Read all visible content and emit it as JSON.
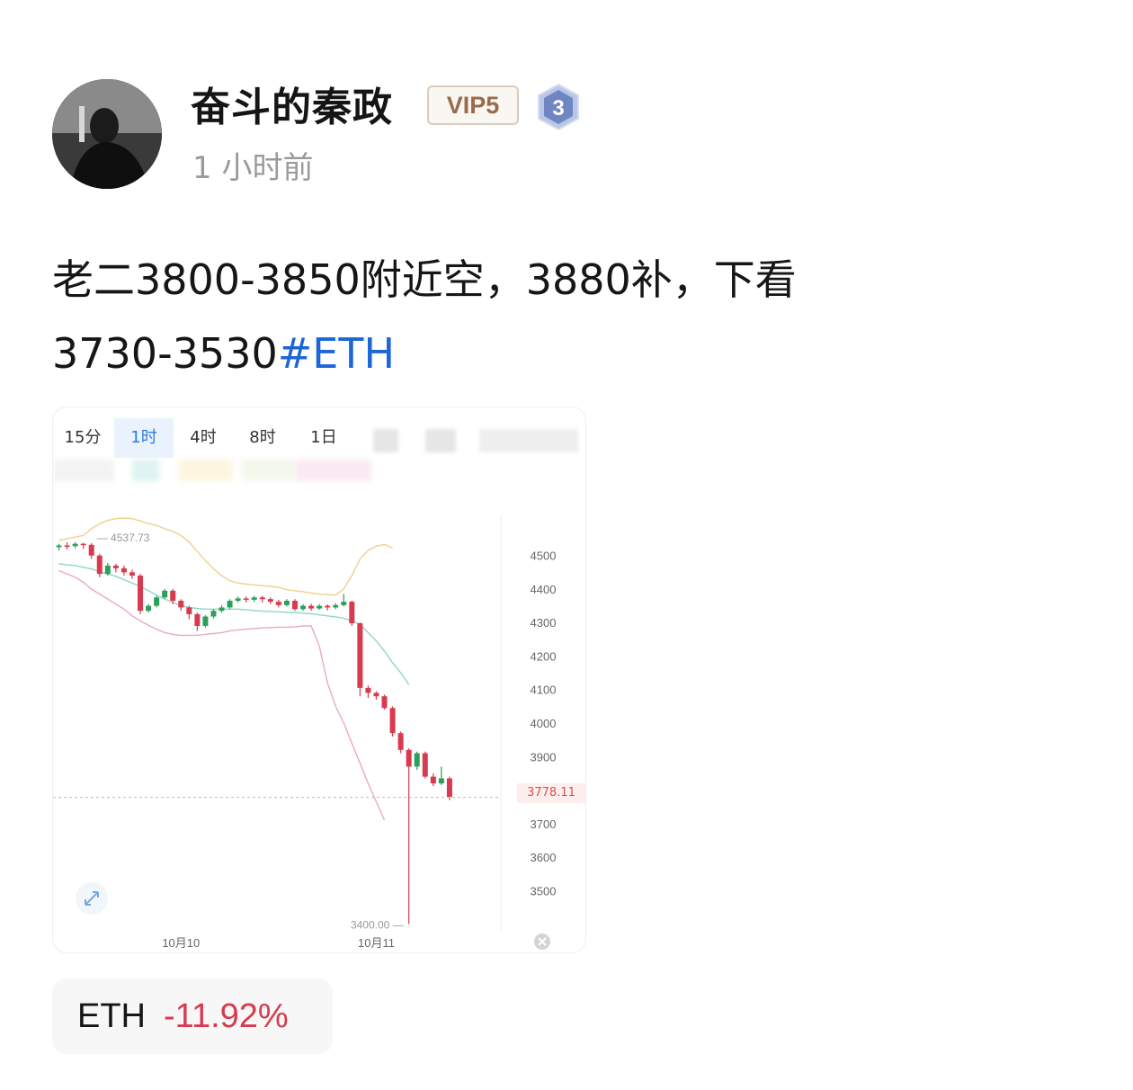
{
  "user": {
    "name": "奋斗的秦政",
    "vip": "VIP5",
    "level": "3",
    "time": "1 小时前"
  },
  "post": {
    "text": "老二3800-3850附近空，3880补，下看3730-3530",
    "hashtag": "#ETH"
  },
  "colors": {
    "up": "#2e9e5b",
    "down": "#d83a4f",
    "link": "#1d66d8"
  },
  "chart_tabs": [
    {
      "label": "15分",
      "active": false
    },
    {
      "label": "1时",
      "active": true
    },
    {
      "label": "4时",
      "active": false
    },
    {
      "label": "8时",
      "active": false
    },
    {
      "label": "1日",
      "active": false
    }
  ],
  "chart_data": {
    "type": "candlestick",
    "symbol": "ETH",
    "interval": "1时",
    "y_ticks": [
      4500,
      4400,
      4300,
      4200,
      4100,
      4000,
      3900,
      3700,
      3600,
      3500
    ],
    "ylim": [
      3380,
      4620
    ],
    "x_labels": [
      {
        "label": "10月10",
        "index": 15
      },
      {
        "label": "10月11",
        "index": 39
      }
    ],
    "high_label": "4537.73",
    "low_label": "3400.00",
    "current_price": "3778.11",
    "candles": [
      [
        4525,
        4530,
        4515,
        4535
      ],
      [
        4530,
        4528,
        4518,
        4540
      ],
      [
        4528,
        4535,
        4522,
        4540
      ],
      [
        4535,
        4532,
        4520,
        4538
      ],
      [
        4532,
        4500,
        4490,
        4537
      ],
      [
        4500,
        4445,
        4435,
        4505
      ],
      [
        4445,
        4470,
        4440,
        4478
      ],
      [
        4470,
        4462,
        4450,
        4475
      ],
      [
        4462,
        4450,
        4440,
        4470
      ],
      [
        4450,
        4440,
        4430,
        4458
      ],
      [
        4440,
        4335,
        4325,
        4445
      ],
      [
        4335,
        4350,
        4330,
        4355
      ],
      [
        4350,
        4375,
        4345,
        4380
      ],
      [
        4375,
        4395,
        4370,
        4400
      ],
      [
        4395,
        4365,
        4355,
        4400
      ],
      [
        4365,
        4345,
        4335,
        4370
      ],
      [
        4345,
        4325,
        4310,
        4350
      ],
      [
        4325,
        4290,
        4275,
        4330
      ],
      [
        4290,
        4318,
        4285,
        4322
      ],
      [
        4318,
        4335,
        4312,
        4340
      ],
      [
        4335,
        4345,
        4330,
        4352
      ],
      [
        4345,
        4365,
        4340,
        4370
      ],
      [
        4365,
        4372,
        4360,
        4378
      ],
      [
        4372,
        4368,
        4360,
        4378
      ],
      [
        4368,
        4375,
        4362,
        4380
      ],
      [
        4375,
        4370,
        4360,
        4380
      ],
      [
        4370,
        4362,
        4355,
        4375
      ],
      [
        4362,
        4352,
        4345,
        4368
      ],
      [
        4352,
        4365,
        4348,
        4370
      ],
      [
        4365,
        4340,
        4335,
        4370
      ],
      [
        4340,
        4350,
        4335,
        4355
      ],
      [
        4350,
        4342,
        4335,
        4356
      ],
      [
        4342,
        4350,
        4338,
        4355
      ],
      [
        4350,
        4345,
        4336,
        4354
      ],
      [
        4345,
        4352,
        4340,
        4358
      ],
      [
        4352,
        4362,
        4348,
        4385
      ],
      [
        4362,
        4298,
        4290,
        4365
      ],
      [
        4298,
        4105,
        4080,
        4300
      ],
      [
        4105,
        4090,
        4075,
        4112
      ],
      [
        4090,
        4080,
        4070,
        4095
      ],
      [
        4080,
        4045,
        4040,
        4085
      ],
      [
        4045,
        3970,
        3960,
        4050
      ],
      [
        3970,
        3920,
        3910,
        3975
      ],
      [
        3920,
        3870,
        3400,
        3925
      ],
      [
        3870,
        3910,
        3860,
        3915
      ],
      [
        3910,
        3840,
        3835,
        3915
      ],
      [
        3840,
        3820,
        3812,
        3850
      ],
      [
        3820,
        3835,
        3815,
        3870
      ],
      [
        3835,
        3780,
        3770,
        3840
      ]
    ],
    "upper_band": [
      4545,
      4550,
      4555,
      4560,
      4580,
      4595,
      4605,
      4610,
      4612,
      4610,
      4603,
      4595,
      4590,
      4580,
      4572,
      4560,
      4540,
      4512,
      4485,
      4460,
      4440,
      4425,
      4418,
      4415,
      4412,
      4410,
      4408,
      4405,
      4398,
      4395,
      4392,
      4388,
      4385,
      4383,
      4382,
      4400,
      4440,
      4490,
      4515,
      4528,
      4533,
      4522
    ],
    "middle_band": [
      4475,
      4472,
      4470,
      4465,
      4460,
      4452,
      4445,
      4438,
      4428,
      4418,
      4408,
      4395,
      4382,
      4370,
      4360,
      4350,
      4345,
      4342,
      4340,
      4340,
      4340,
      4340,
      4340,
      4338,
      4336,
      4334,
      4333,
      4332,
      4330,
      4330,
      4328,
      4326,
      4323,
      4320,
      4317,
      4313,
      4305,
      4295,
      4270,
      4245,
      4215,
      4180,
      4150,
      4115
    ],
    "lower_band": [
      4455,
      4445,
      4435,
      4420,
      4400,
      4385,
      4370,
      4355,
      4340,
      4320,
      4305,
      4292,
      4280,
      4270,
      4265,
      4262,
      4262,
      4262,
      4265,
      4267,
      4270,
      4275,
      4278,
      4280,
      4282,
      4284,
      4285,
      4286,
      4286,
      4287,
      4290,
      4290,
      4230,
      4120,
      4050,
      4000,
      3940,
      3880,
      3820,
      3765,
      3710
    ]
  },
  "ticker": {
    "symbol": "ETH",
    "change": "-11.92%"
  }
}
